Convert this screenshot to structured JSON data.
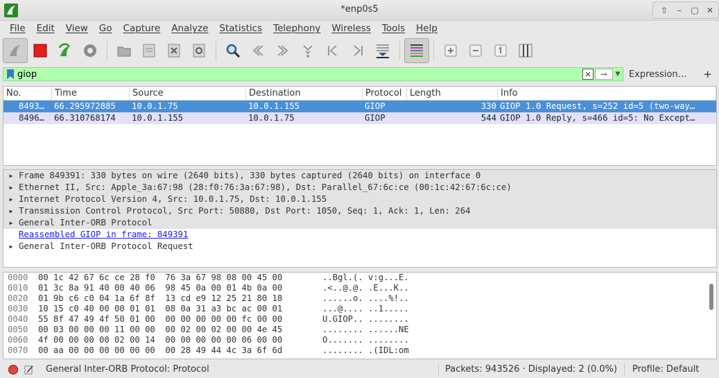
{
  "window": {
    "title": "*enp0s5"
  },
  "menu": [
    "File",
    "Edit",
    "View",
    "Go",
    "Capture",
    "Analyze",
    "Statistics",
    "Telephony",
    "Wireless",
    "Tools",
    "Help"
  ],
  "toolbar_icons": [
    "shark-fin-icon",
    "stop-icon",
    "restart-icon",
    "options-icon",
    "open-icon",
    "save-icon",
    "close-file-icon",
    "reload-icon",
    "find-icon",
    "back-icon",
    "forward-icon",
    "go-to-icon",
    "first-icon",
    "last-icon",
    "autoscroll-icon",
    "colorize-icon",
    "zoom-in-icon",
    "zoom-out-icon",
    "normal-size-icon",
    "resize-columns-icon"
  ],
  "filter": {
    "value": "giop",
    "expression_label": "Expression…",
    "plus_label": "+"
  },
  "packet_list": {
    "columns": [
      "No.",
      "Time",
      "Source",
      "Destination",
      "Protocol",
      "Length",
      "Info"
    ],
    "rows": [
      {
        "no": "8493…",
        "time": "66.295972885",
        "source": "10.0.1.75",
        "destination": "10.0.1.155",
        "protocol": "GIOP",
        "length": "330",
        "info": "GIOP 1.0 Request, s=252 id=5 (two-way…",
        "selected": true
      },
      {
        "no": "8496…",
        "time": "66.310768174",
        "source": "10.0.1.155",
        "destination": "10.0.1.75",
        "protocol": "GIOP",
        "length": "544",
        "info": "GIOP 1.0 Reply, s=466 id=5: No Except…",
        "selected": false
      }
    ]
  },
  "details": [
    {
      "text": "Frame 849391: 330 bytes on wire (2640 bits), 330 bytes captured (2640 bits) on interface 0",
      "expandable": true,
      "shaded": true
    },
    {
      "text": "Ethernet II, Src: Apple_3a:67:98 (28:f0:76:3a:67:98), Dst: Parallel_67:6c:ce (00:1c:42:67:6c:ce)",
      "expandable": true,
      "shaded": true
    },
    {
      "text": "Internet Protocol Version 4, Src: 10.0.1.75, Dst: 10.0.1.155",
      "expandable": true,
      "shaded": true
    },
    {
      "text": "Transmission Control Protocol, Src Port: 50880, Dst Port: 1050, Seq: 1, Ack: 1, Len: 264",
      "expandable": true,
      "shaded": true
    },
    {
      "text": "General Inter-ORB Protocol",
      "expandable": true,
      "shaded": true
    },
    {
      "text": "Reassembled GIOP in frame: 849391",
      "expandable": false,
      "shaded": false,
      "link": true
    },
    {
      "text": "General Inter-ORB Protocol Request",
      "expandable": true,
      "shaded": false
    }
  ],
  "bytes": [
    {
      "offset": "0000",
      "hex": "00 1c 42 67 6c ce 28 f0  76 3a 67 98 08 00 45 00",
      "ascii": "..Bgl.(. v:g...E."
    },
    {
      "offset": "0010",
      "hex": "01 3c 8a 91 40 00 40 06  98 45 0a 00 01 4b 0a 00",
      "ascii": ".<..@.@. .E...K.."
    },
    {
      "offset": "0020",
      "hex": "01 9b c6 c0 04 1a 6f 8f  13 cd e9 12 25 21 80 18",
      "ascii": "......o. ....%!.."
    },
    {
      "offset": "0030",
      "hex": "10 15 c0 40 00 00 01 01  08 0a 31 a3 bc ac 00 01",
      "ascii": "...@.... ..1....."
    },
    {
      "offset": "0040",
      "hex": "55 8f 47 49 4f 50 01 00  00 00 00 00 00 fc 00 00",
      "ascii": "U.GIOP.. ........"
    },
    {
      "offset": "0050",
      "hex": "00 03 00 00 00 11 00 00  00 02 00 02 00 00 4e 45",
      "ascii": "........ ......NE"
    },
    {
      "offset": "0060",
      "hex": "4f 00 00 00 00 02 00 14  00 00 00 00 00 06 00 00",
      "ascii": "O....... ........"
    },
    {
      "offset": "0070",
      "hex": "00 aa 00 00 00 00 00 00  00 28 49 44 4c 3a 6f 6d",
      "ascii": "........ .(IDL:om"
    }
  ],
  "status": {
    "message": "General Inter-ORB Protocol: Protocol",
    "packets": "Packets: 943526 · Displayed: 2 (0.0%)",
    "profile": "Profile: Default"
  }
}
